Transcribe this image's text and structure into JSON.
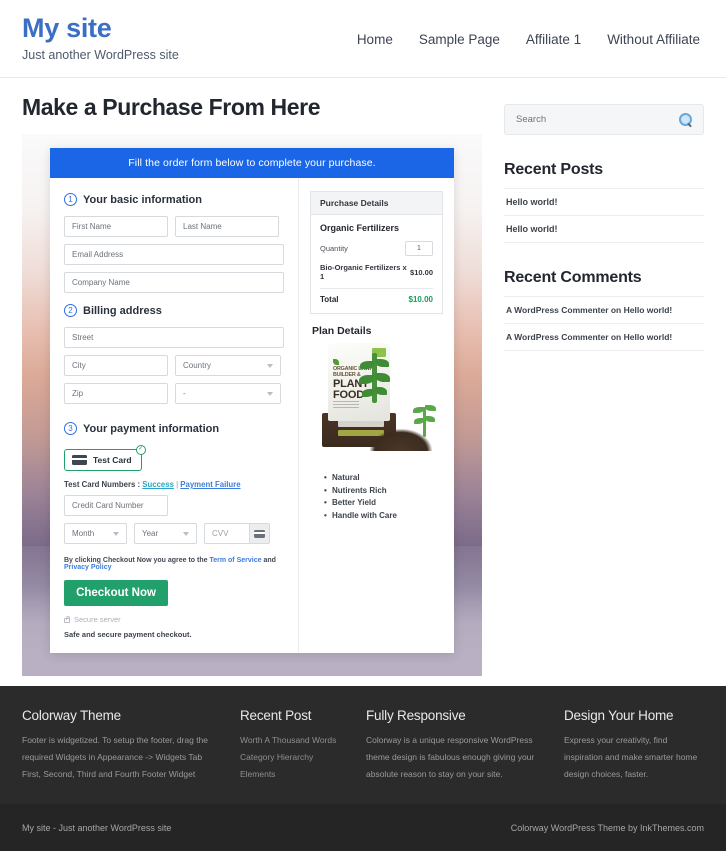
{
  "header": {
    "brand_title": "My site",
    "brand_tagline": "Just another WordPress site",
    "nav": [
      {
        "label": "Home"
      },
      {
        "label": "Sample Page"
      },
      {
        "label": "Affiliate 1"
      },
      {
        "label": "Without Affiliate"
      }
    ]
  },
  "main": {
    "page_title": "Make a Purchase From Here",
    "order_form": {
      "banner": "Fill the order form below to complete your purchase.",
      "step1": {
        "number": "1",
        "label": "Your basic information",
        "first_name_placeholder": "First Name",
        "last_name_placeholder": "Last Name",
        "email_placeholder": "Email Address",
        "company_placeholder": "Company Name"
      },
      "step2": {
        "number": "2",
        "label": "Billing address",
        "street_placeholder": "Street",
        "city_placeholder": "City",
        "country_placeholder": "Country",
        "zip_placeholder": "Zip",
        "state_placeholder": "-"
      },
      "step3": {
        "number": "3",
        "label": "Your payment information",
        "tab_label": "Test  Card",
        "tab_check": "✓",
        "testcard_prefix": "Test Card Numbers : ",
        "testcard_success": "Success",
        "testcard_sep": " | ",
        "testcard_failure": "Payment Failure",
        "card_number_placeholder": "Credit Card Number",
        "month_placeholder": "Month",
        "year_placeholder": "Year",
        "cvv_placeholder": "CVV",
        "terms_prefix": "By clicking Checkout Now you agree to the ",
        "terms_link1": "Term of Service",
        "terms_mid": " and ",
        "terms_link2": "Privacy Policy",
        "checkout_label": "Checkout Now",
        "secure_server": "Secure server",
        "safe_text": "Safe and secure payment checkout."
      }
    },
    "purchase_details": {
      "panel_title": "Purchase Details",
      "product_name": "Organic Fertilizers",
      "quantity_label": "Quantity",
      "quantity_value": "1",
      "line_item_label": "Bio-Organic Fertilizers x 1",
      "line_item_amount": "$10.00",
      "total_label": "Total",
      "total_amount": "$10.00"
    },
    "plan_details": {
      "title": "Plan Details",
      "product_image_alt": "Organic Lawn Builder & Plant Food bag",
      "bag_line1": "ORGANIC LAWN",
      "bag_line2": "BUILDER &",
      "bag_line3": "PLANT",
      "bag_line4": "FOOD",
      "features": [
        "Natural",
        "Nutirents Rich",
        "Better Yield",
        "Handle with Care"
      ]
    }
  },
  "sidebar": {
    "search_placeholder": "Search",
    "recent_posts": {
      "title": "Recent Posts",
      "items": [
        {
          "label": "Hello world!"
        },
        {
          "label": "Hello world!"
        }
      ]
    },
    "recent_comments": {
      "title": "Recent Comments",
      "items": [
        {
          "label": "A WordPress Commenter on Hello world!"
        },
        {
          "label": "A WordPress Commenter on Hello world!"
        }
      ]
    }
  },
  "footer": {
    "widgets": [
      {
        "title": "Colorway Theme",
        "text": "Footer is widgetized. To setup the footer, drag the required Widgets in Appearance -> Widgets Tab First, Second, Third and Fourth Footer Widget"
      },
      {
        "title": "Recent Post",
        "items": [
          {
            "label": "Worth A Thousand Words"
          },
          {
            "label": "Category Hierarchy"
          },
          {
            "label": "Elements"
          }
        ]
      },
      {
        "title": "Fully Responsive",
        "text": "Colorway is a unique responsive WordPress theme design is fabulous enough giving your absolute reason to stay on your site."
      },
      {
        "title": "Design Your Home",
        "text": "Express your creativity, find inspiration and make smarter home design choices, faster."
      }
    ],
    "copyright_left": "My site - Just another WordPress site",
    "copyright_right": "Colorway WordPress Theme by InkThemes.com"
  },
  "colors": {
    "brand": "#3b6fc4",
    "banner_blue": "#1a66e6",
    "checkout_green": "#22a06b",
    "total_green": "#16a05a",
    "link_blue": "#3b7ddd",
    "link_teal": "#2aa5c4",
    "footer_dark": "#2b2b2b"
  }
}
